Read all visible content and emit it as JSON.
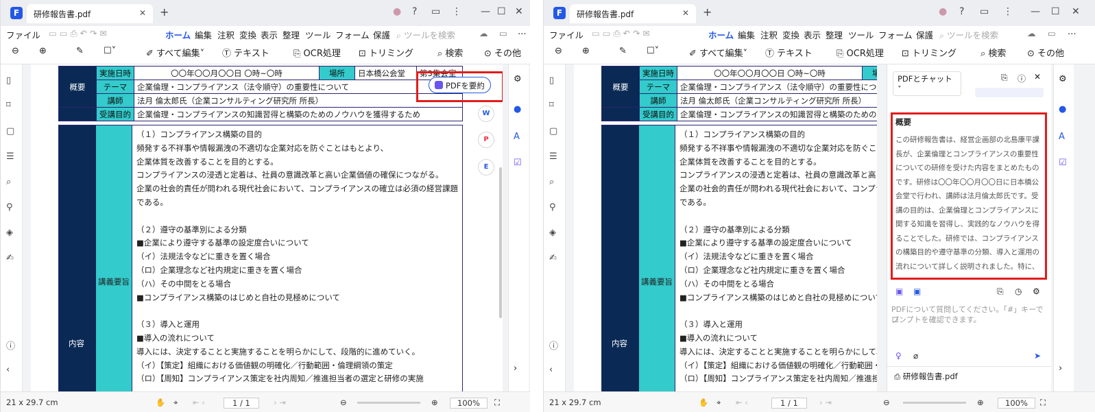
{
  "window": {
    "tab_title": "研修報告書.pdf",
    "menu": [
      "ファイル",
      "ホーム",
      "編集",
      "注釈",
      "変換",
      "表示",
      "整理",
      "ツール",
      "フォーム",
      "保護"
    ],
    "search_placeholder": "ツールを検索",
    "more_glyph": "⋯"
  },
  "toolbar": {
    "edit_all": "すべて編集",
    "text": "テキスト",
    "ocr": "OCR処理",
    "trim": "トリミング",
    "search": "検索",
    "other": "その他"
  },
  "document": {
    "meta_labels": {
      "date": "実施日時",
      "place": "場所",
      "overview": "概要",
      "theme": "テーマ",
      "lecturer": "講師",
      "purpose": "受講目的"
    },
    "date_value": "〇〇年〇〇月〇〇日 〇時~〇時",
    "place_value": "日本橋公会堂",
    "room_value": "第3集会室",
    "theme_value": "企業倫理・コンプライアンス（法令順守）の重要性について",
    "lecturer_value": "法月 倫太郎氏（企業コンサルティング研究所 所長）",
    "purpose_value": "企業倫理・コンプライアンスの知識習得と構築のためのノウハウを獲得するため",
    "content_label": "内容",
    "section_label": "講義要旨",
    "lines": [
      "（１）コンプライアンス構築の目的",
      "頻発する不祥事や情報漏洩の不適切な企業対応を防ぐことはもとより、",
      "企業体質を改善することを目的とする。",
      "コンプライアンスの浸透と定着は、社員の意識改革と高い企業価値の確保につながる。",
      "企業の社会的責任が問われる現代社会において、コンプライアンスの確立は必須の経営課題",
      "である。",
      "",
      "（２）遵守の基準別による分類",
      " ■企業により遵守する基準の設定度合いについて",
      " （イ）法規法令などに重きを置く場合",
      " （ロ）企業理念など社内規定に重きを置く場合",
      " （ハ）その中間をとる場合",
      " ■コンプライアンス構築のはじめと自社の見極めについて",
      "",
      "（３）導入と運用",
      " ■導入の流れについて",
      " 導入には、決定することと実施することを明らかにして、段階的に進めていく。",
      " （イ）【策定】組織における価値観の明確化／行動範囲・倫理綱領の策定",
      " （ロ）【周知】コンプライアンス策定を社内周知／推進担当者の選定と研修の実施"
    ]
  },
  "summarize_button": "PDFを要約",
  "floating_icons": [
    "W",
    "P",
    "E"
  ],
  "status": {
    "size": "21 x 29.7 cm",
    "page": "1 / 1",
    "zoom": "100%"
  },
  "chat": {
    "dropdown": "PDFとチャット",
    "summary_title": "概要",
    "summary_lines": [
      "この研修報告書は、経営企画部の北島康平課",
      "長が、企業倫理とコンプライアンスの重要性",
      "についての研修を受けた内容をまとめたもの",
      "です。研修は〇〇年〇〇月〇〇日に日本橋公",
      "会堂で行われ、講師は法月倫太郎氏です。受",
      "講の目的は、企業倫理とコンプライアンスに",
      "関する知識を習得し、実践的なノウハウを得",
      "ることでした。研修では、コンプライアンス",
      "の構築目的や遵守基準の分類、導入と運用の",
      "流れについて詳しく説明されました。特に、"
    ],
    "input_placeholder_line1": "PDFについて質問してください。「#」キーでプ",
    "input_placeholder_line2": "ロンプトを確認できます。",
    "file_name": "研修報告書.pdf"
  },
  "colors": {
    "accent": "#2458e6",
    "header_navy": "#0a2a55",
    "teal": "#33cbcc",
    "highlight_red": "#e31b1b"
  }
}
